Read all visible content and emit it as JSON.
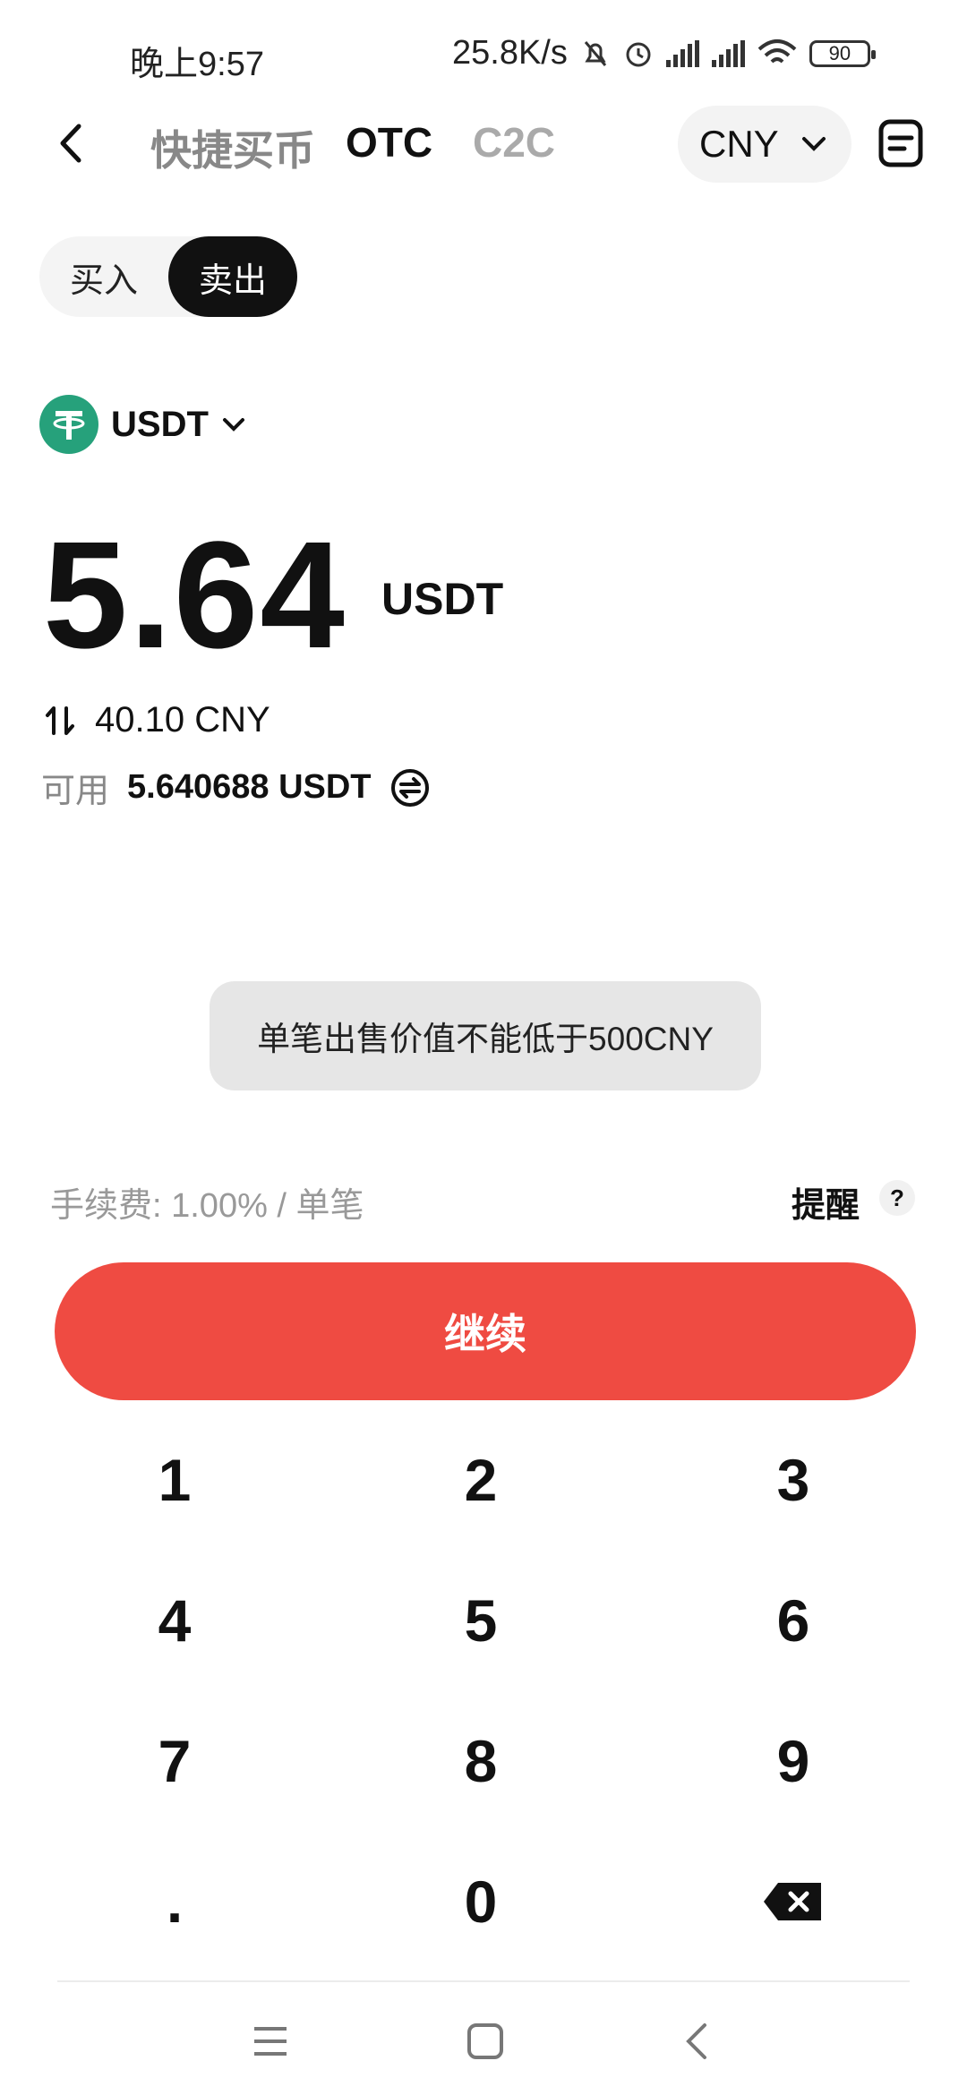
{
  "status_bar": {
    "time": "晚上9:57",
    "net_speed": "25.8K/s",
    "battery": "90"
  },
  "header": {
    "tabs": [
      {
        "label": "快捷买币",
        "active": false
      },
      {
        "label": "OTC",
        "active": true
      },
      {
        "label": "C2C",
        "active": false
      }
    ],
    "currency": "CNY"
  },
  "trade_mode": {
    "buy_label": "买入",
    "sell_label": "卖出",
    "selected": "卖出"
  },
  "coin": {
    "symbol": "USDT",
    "logo_letter": "₮",
    "logo_color": "#26a17b"
  },
  "amount": {
    "value": "5.64",
    "unit": "USDT",
    "converted": "40.10 CNY",
    "available_label": "可用",
    "available_value": "5.640688 USDT"
  },
  "toast": {
    "message": "单笔出售价值不能低于500CNY"
  },
  "fee": {
    "label": "手续费:  1.00% / 单笔",
    "remind_label": "提醒",
    "help_symbol": "?"
  },
  "continue_label": "继续",
  "continue_color": "#ef4b42",
  "keypad": [
    "1",
    "2",
    "3",
    "4",
    "5",
    "6",
    "7",
    "8",
    "9",
    ".",
    "0",
    "backspace"
  ],
  "icons": {
    "back": "back-arrow-icon",
    "orders": "order-list-icon",
    "dropdown": "chevron-down-icon",
    "swap": "swap-vertical-icon",
    "convert": "convert-circle-icon",
    "backspace": "backspace-icon"
  }
}
